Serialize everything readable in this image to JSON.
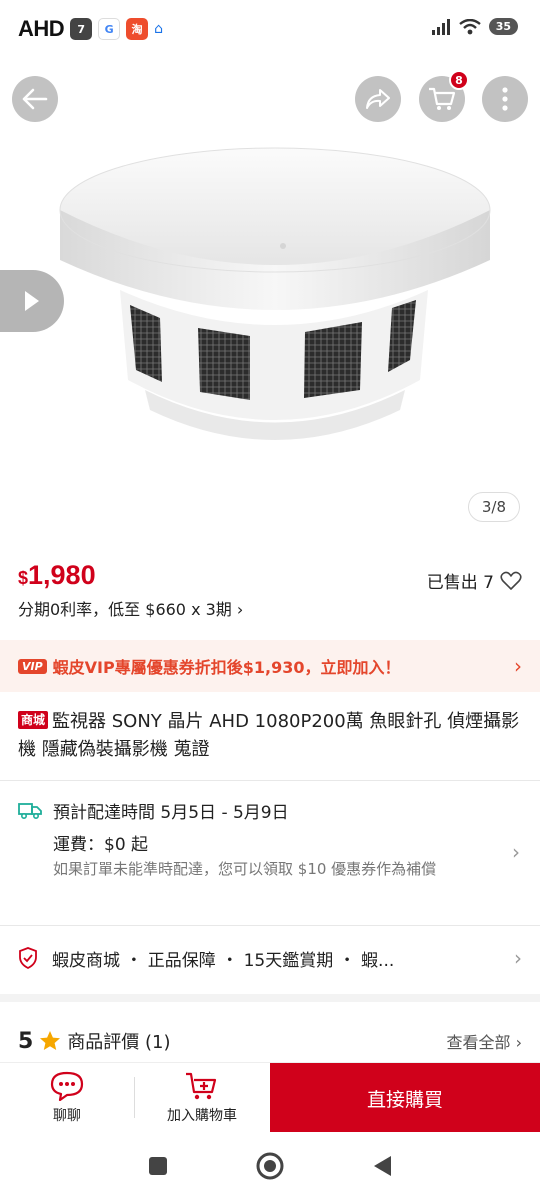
{
  "status_bar": {
    "carrier": "AHD",
    "battery": "35"
  },
  "hero": {
    "cart_count": "8",
    "image_counter": "3/8"
  },
  "product": {
    "currency": "$",
    "price": "1,980",
    "sold": "已售出 7",
    "installment": "分期0利率，低至 $660 x 3期 ›",
    "vip_tag": "VIP",
    "vip_promo": "蝦皮VIP專屬優惠券折扣後$1,930，立即加入！",
    "mall_tag": "商城",
    "title": "監視器 SONY 晶片 AHD 1080P200萬 魚眼針孔 偵煙攝影機 隱藏偽裝攝影機 蒐證"
  },
  "shipping": {
    "eta": "預計配達時間 5月5日 - 5月9日",
    "fee": "運費：$0 起",
    "note": "如果訂單未能準時配達，您可以領取 $10 優惠券作為補償"
  },
  "guarantee": {
    "text": "蝦皮商城 ・ 正品保障 ・ 15天鑑賞期 ・ 蝦..."
  },
  "reviews": {
    "rating": "5",
    "label": "商品評價 (1)",
    "see_all": "查看全部"
  },
  "bottom_bar": {
    "chat": "聊聊",
    "add_to_cart": "加入購物車",
    "buy_now": "直接購買"
  },
  "colors": {
    "brand_red": "#d0011b",
    "vip_orange": "#e4462c",
    "vip_bg": "#fdf2ee"
  }
}
